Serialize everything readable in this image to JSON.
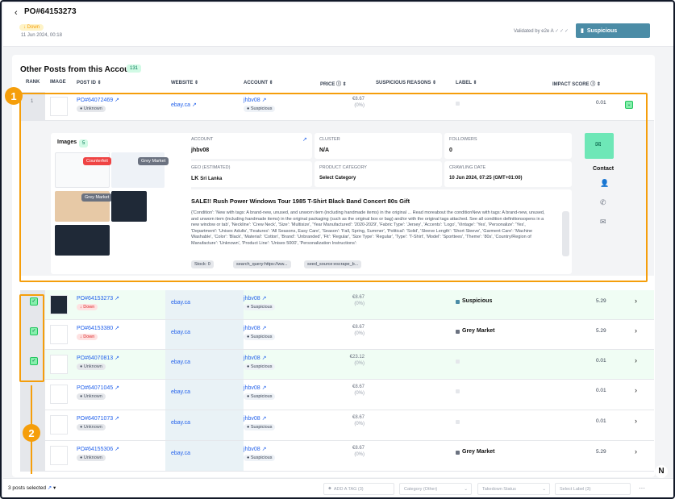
{
  "header": {
    "back_icon": "chevron-left-icon",
    "title": "PO#64153273",
    "status_badge": "Down",
    "date": "11 Jun 2024, 00:18",
    "validated_text": "Validated by e2e A",
    "validated_checks": "✓✓✓",
    "suspicious_button": "Suspicious"
  },
  "section": {
    "title": "Other Posts from this Account",
    "count": "131"
  },
  "columns": {
    "rank": "RANK",
    "image": "IMAGE",
    "post_id": "POST ID",
    "website": "WEBSITE",
    "account": "ACCOUNT",
    "price": "PRICE",
    "reasons": "SUSPICIOUS REASONS",
    "label": "LABEL",
    "impact": "IMPACT SCORE"
  },
  "rows": [
    {
      "rank": "1",
      "post_id": "PO#64072469",
      "status": "Unknown",
      "website": "ebay.ca",
      "account": "jhbv08",
      "account_badge": "Suspicious",
      "price": "€8.67",
      "pct": "(0%)",
      "label": "",
      "impact": "0.01"
    },
    {
      "rank": "",
      "post_id": "PO#64153273",
      "status": "Down",
      "website": "ebay.ca",
      "account": "jhbv08",
      "account_badge": "Suspicious",
      "price": "€8.67",
      "pct": "(0%)",
      "label": "Suspicious",
      "impact": "5.29"
    },
    {
      "rank": "",
      "post_id": "PO#64153380",
      "status": "Down",
      "website": "ebay.ca",
      "account": "jhbv08",
      "account_badge": "Suspicious",
      "price": "€8.67",
      "pct": "(0%)",
      "label": "Grey Market",
      "impact": "5.29"
    },
    {
      "rank": "",
      "post_id": "PO#64070813",
      "status": "Unknown",
      "website": "ebay.ca",
      "account": "jhbv08",
      "account_badge": "Suspicious",
      "price": "€23.12",
      "pct": "(0%)",
      "label": "",
      "impact": "0.01"
    },
    {
      "rank": "",
      "post_id": "PO#64071045",
      "status": "Unknown",
      "website": "ebay.ca",
      "account": "jhbv08",
      "account_badge": "Suspicious",
      "price": "€8.67",
      "pct": "(0%)",
      "label": "",
      "impact": "0.01"
    },
    {
      "rank": "",
      "post_id": "PO#64071073",
      "status": "Unknown",
      "website": "ebay.ca",
      "account": "jhbv08",
      "account_badge": "Suspicious",
      "price": "€8.67",
      "pct": "(0%)",
      "label": "",
      "impact": "0.01"
    },
    {
      "rank": "",
      "post_id": "PO#64155306",
      "status": "Unknown",
      "website": "ebay.ca",
      "account": "jhbv08",
      "account_badge": "Suspicious",
      "price": "€8.67",
      "pct": "(0%)",
      "label": "Grey Market",
      "impact": "5.29"
    }
  ],
  "detail": {
    "images_title": "Images",
    "images_count": "5",
    "img_tag_counterfeit": "Counterfeit",
    "img_tag_grey": "Grey Market",
    "img_tag_grey2": "Grey Market",
    "account_label": "ACCOUNT",
    "account_value": "jhbv08",
    "cluster_label": "CLUSTER",
    "cluster_value": "N/A",
    "followers_label": "FOLLOWERS",
    "followers_value": "0",
    "geo_label": "GEO (ESTIMATED)",
    "geo_code": "LK",
    "geo_value": "Sri Lanka",
    "category_label": "PRODUCT CATEGORY",
    "category_value": "Select Category",
    "crawling_label": "CRAWLING DATE",
    "crawling_value": "10 Jun 2024, 07:25 (GMT+01:00)",
    "post_title": "SALE!! Rush Power Windows Tour 1985 T-Shirt Black Band Concert 80s Gift",
    "description": "{'Condition': 'New with tags: A brand-new, unused, and unworn item (including handmade items) in the original ... Read moreabout the conditionNew with tags: A brand-new, unused, and unworn item (including handmade items) in the original packaging (such as the original box or bag) and/or with the original tags attached. See all condition definitionsopens in a new window or tab', 'Neckline': 'Crew Neck', 'Size': 'Multisize', 'Year Manufactured': '2020-2029', 'Fabric Type': 'Jersey', 'Accents': 'Logo', 'Vintage': 'Yes', 'Personalize': 'Yes', 'Department': 'Unisex Adults', 'Features': 'All Seasons, Easy Care', 'Season': 'Fall, Spring, Summer', 'Political': 'Solid', 'Sleeve Length': 'Short Sleeve', 'Garment Care': 'Machine Washable', 'Color': 'Black', 'Material': 'Cotton', 'Brand': 'Unbranded', 'Fit': 'Regular', 'Size Type': 'Regular', 'Type': 'T-Shirt', 'Model': 'Sporttees', 'Theme': '80s', 'Country/Region of Manufacture': 'Unknown', 'Product Line': 'Unisex 5000', 'Personalization Instructions':",
    "stock_chip": "Stock: 0",
    "chip_search": "search_query:https://ww...",
    "chip_seed": "seed_source:escrape_b...",
    "contact_title": "Contact"
  },
  "annotations": {
    "one": "1",
    "two": "2"
  },
  "bottom": {
    "selected_text": "3 posts selected",
    "add_tag": "ADD A TAG (3)",
    "category": "Category (Other)",
    "takedown": "Takedown Status",
    "select_label": "Select Label (3)",
    "more": "···"
  },
  "colors": {
    "accent": "#4b8ca6",
    "annotation": "#f59e0b",
    "selected": "#86efac"
  }
}
